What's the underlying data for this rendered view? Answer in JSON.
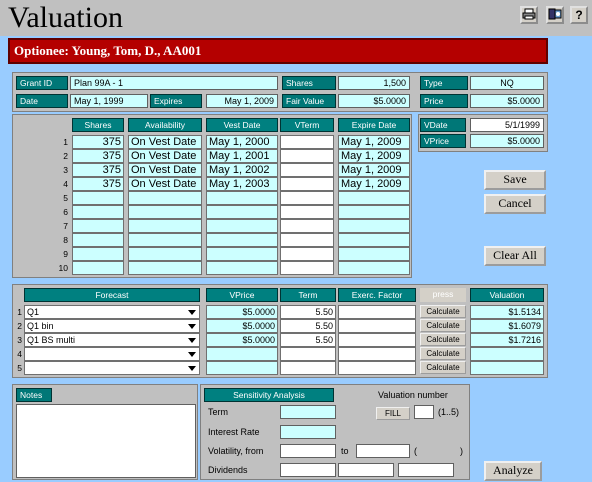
{
  "window": {
    "title": "Valuation"
  },
  "toolbar": {
    "print_icon": "printer-icon",
    "settings_icon": "settings-icon",
    "help_label": "?"
  },
  "banner": {
    "text": "Optionee: Young, Tom, D., AA001"
  },
  "grant": {
    "grant_id_label": "Grant ID",
    "grant_id": "Plan 99A - 1",
    "date_label": "Date",
    "date": "May 1, 1999",
    "expires_label": "Expires",
    "expires": "May 1, 2009",
    "shares_label": "Shares",
    "shares": "1,500",
    "fair_value_label": "Fair Value",
    "fair_value": "$5.0000",
    "type_label": "Type",
    "type": "NQ",
    "price_label": "Price",
    "price": "$5.0000"
  },
  "vest": {
    "headers": {
      "shares": "Shares",
      "availability": "Availability",
      "vest_date": "Vest Date",
      "vterm": "VTerm",
      "expire_date": "Expire Date"
    },
    "rows": [
      {
        "num": "1",
        "shares": "375",
        "availability": "On Vest Date",
        "vest_date": "May  1, 2000",
        "vterm": "",
        "expire_date": "May  1, 2009"
      },
      {
        "num": "2",
        "shares": "375",
        "availability": "On Vest Date",
        "vest_date": "May  1, 2001",
        "vterm": "",
        "expire_date": "May  1, 2009"
      },
      {
        "num": "3",
        "shares": "375",
        "availability": "On Vest Date",
        "vest_date": "May  1, 2002",
        "vterm": "",
        "expire_date": "May  1, 2009"
      },
      {
        "num": "4",
        "shares": "375",
        "availability": "On Vest Date",
        "vest_date": "May  1, 2003",
        "vterm": "",
        "expire_date": "May  1, 2009"
      },
      {
        "num": "5",
        "shares": "",
        "availability": "",
        "vest_date": "",
        "vterm": "",
        "expire_date": ""
      },
      {
        "num": "6",
        "shares": "",
        "availability": "",
        "vest_date": "",
        "vterm": "",
        "expire_date": ""
      },
      {
        "num": "7",
        "shares": "",
        "availability": "",
        "vest_date": "",
        "vterm": "",
        "expire_date": ""
      },
      {
        "num": "8",
        "shares": "",
        "availability": "",
        "vest_date": "",
        "vterm": "",
        "expire_date": ""
      },
      {
        "num": "9",
        "shares": "",
        "availability": "",
        "vest_date": "",
        "vterm": "",
        "expire_date": ""
      },
      {
        "num": "10",
        "shares": "",
        "availability": "",
        "vest_date": "",
        "vterm": "",
        "expire_date": ""
      }
    ]
  },
  "vdate": {
    "vdate_label": "VDate",
    "vdate": "5/1/1999",
    "vprice_label": "VPrice",
    "vprice": "$5.0000"
  },
  "buttons": {
    "save": "Save",
    "cancel": "Cancel",
    "clear_all": "Clear All",
    "analyze": "Analyze"
  },
  "forecast": {
    "headers": {
      "forecast": "Forecast",
      "vprice": "VPrice",
      "term": "Term",
      "exerc": "Exerc. Factor",
      "press": "press",
      "valuation": "Valuation"
    },
    "rows": [
      {
        "num": "1",
        "forecast": "Q1",
        "vprice": "$5.0000",
        "term": "5.50",
        "exerc": "",
        "button": "Calculate",
        "valuation": "$1.5134"
      },
      {
        "num": "2",
        "forecast": "Q1 bin",
        "vprice": "$5.0000",
        "term": "5.50",
        "exerc": "",
        "button": "Calculate",
        "valuation": "$1.6079"
      },
      {
        "num": "3",
        "forecast": "Q1 BS multi",
        "vprice": "$5.0000",
        "term": "5.50",
        "exerc": "",
        "button": "Calculate",
        "valuation": "$1.7216"
      },
      {
        "num": "4",
        "forecast": "",
        "vprice": "",
        "term": "",
        "exerc": "",
        "button": "Calculate",
        "valuation": ""
      },
      {
        "num": "5",
        "forecast": "",
        "vprice": "",
        "term": "",
        "exerc": "",
        "button": "Calculate",
        "valuation": ""
      }
    ]
  },
  "notes": {
    "label": "Notes",
    "value": ""
  },
  "sensitivity": {
    "title": "Sensitivity Analysis",
    "term_label": "Term",
    "interest_label": "Interest Rate",
    "volatility_label": "Volatility, from",
    "to_label": "to",
    "paren_open": "(",
    "paren_close": ")",
    "dividends_label": "Dividends",
    "valuation_number_label": "Valuation number",
    "fill_button": "FILL",
    "range_hint": "(1..5)"
  }
}
